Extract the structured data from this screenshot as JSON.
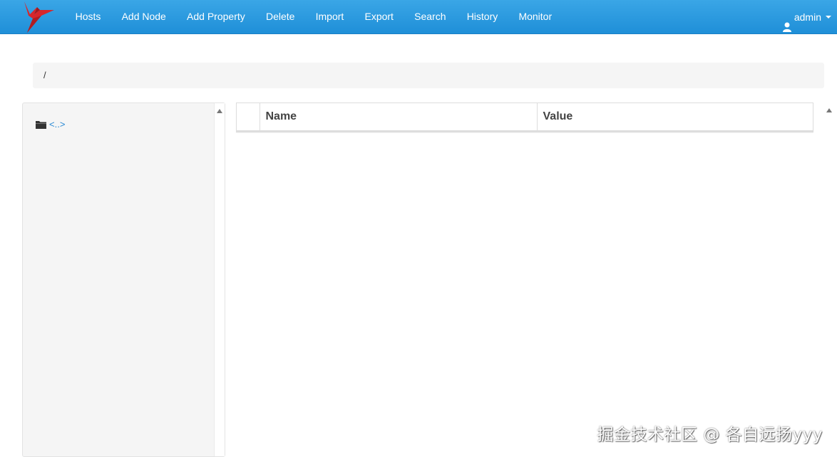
{
  "navbar": {
    "brand_icon": "red-bird-logo",
    "items": [
      {
        "label": "Hosts"
      },
      {
        "label": "Add Node"
      },
      {
        "label": "Add Property"
      },
      {
        "label": "Delete"
      },
      {
        "label": "Import"
      },
      {
        "label": "Export"
      },
      {
        "label": "Search"
      },
      {
        "label": "History"
      },
      {
        "label": "Monitor"
      }
    ],
    "user": {
      "label": "admin",
      "icon": "user-icon"
    },
    "accent_color": "#2a97dd"
  },
  "breadcrumb": {
    "path": "/"
  },
  "tree": {
    "items": [
      {
        "label": "<..>",
        "icon": "folder-icon"
      }
    ]
  },
  "properties_table": {
    "columns": [
      "Name",
      "Value"
    ],
    "rows": []
  },
  "watermark": {
    "text": "掘金技术社区 @ 各自远扬yyy"
  }
}
